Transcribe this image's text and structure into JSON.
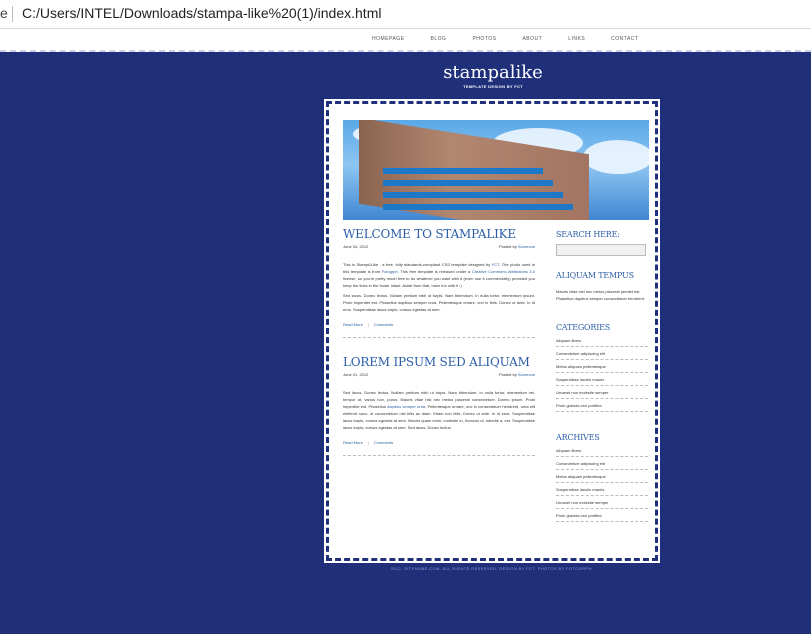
{
  "browser": {
    "address": "C:/Users/INTEL/Downloads/stampa-like%20(1)/index.html"
  },
  "nav": [
    "HOMEPAGE",
    "BLOG",
    "PHOTOS",
    "ABOUT",
    "LINKS",
    "CONTACT"
  ],
  "brand": {
    "name": "stampalike",
    "tagline": "TEMPLATE DESIGN BY FCT"
  },
  "posts": [
    {
      "title": "WELCOME TO STAMPALIKE",
      "date": "June 04, 2012",
      "posted_by_label": "Posted by",
      "author": "Someone",
      "p1_a": "This is StampALike , a free, fully standards-compliant CSS template designed by ",
      "p1_link1": "FCT",
      "p1_b": ". The photo used in this template is from ",
      "p1_link2": "Fotogrph",
      "p1_c": ". This free template is released under a ",
      "p1_link3": "Creative Commons Attributions 3.0",
      "p1_d": " license, so you're pretty much free to do whatever you want with it (even use it commercially) provided you keep the links in the footer intact. Aside from that, have fun with it :)",
      "p2": "Sed lacus. Donec lectus. Nullam pretium nibh ut turpis. Nam bibendum. In nulla tortor, elementum ipsum. Proin imperdiet est. Phasellus dapibus semper urna. Pellentesque ornare, orci in felis. Donec ut ante. In id eros. Suspendisse lacus turpis, cursus egestas at sem.",
      "read_more": "Read More",
      "comments": "Comments"
    },
    {
      "title": "LOREM IPSUM SED ALIQUAM",
      "date": "June 01, 2012",
      "posted_by_label": "Posted by",
      "author": "Someone",
      "p1_a": "Sed lacus. Donec lectus. Nullam pretium nibh ut turpis. Nam bibendum. In nulla tortor, elementum vel, tempor at, varius non, purus. Mauris vitae nisl nec metus placerat consectetuer. Donec ipsum. Proin imperdiet est. Phasellus ",
      "p1_link1": "dapibus semper urna",
      "p1_b": ". Pellentesque ornare, orci in consectetuer hendrerit, urna elit eleifend nunc, ut consectetuer nisl felis ac diam. Etiam non felis. Donec ut ante. In id eros. Suspendisse lacus turpis, cursus egestas at sem. Mauris quam enim, molestie in, rhoncus ut, lobortis a, est. Suspendisse lacus turpis, cursus egestas at sem. Sed lacus. Donec lectus.",
      "read_more": "Read More",
      "comments": "Comments"
    }
  ],
  "sidebar": {
    "search_title": "SEARCH HERE:",
    "about_title": "ALIQUAM TEMPUS",
    "about_text": "Mauris vitae nisl nec metus placerat perdiet est. Phasellus dapibus semper consectetuer hendrerit.",
    "categories_title": "CATEGORIES",
    "categories": [
      "Aliquam libero",
      "Consectetuer adipiscing elit",
      "Metus aliquam pellentesque",
      "Suspendisse iaculis mauris",
      "Urnanet non molestie semper",
      "Proin gravida orci porttitor"
    ],
    "archives_title": "ARCHIVES",
    "archives": [
      "Aliquam libero",
      "Consectetuer adipiscing elit",
      "Metus aliquam pellentesque",
      "Suspendisse iaculis mauris",
      "Urnanet non molestie semper",
      "Proin gravida orci porttitor"
    ]
  },
  "footer": {
    "text": "2012. SITENAME.COM. ALL RIGHTS RESERVED. DESIGN BY FCT. PHOTOS BY FOTOGRPH."
  },
  "colors": {
    "page_bg": "#1f2f7a",
    "accent": "#2b5ea7"
  }
}
